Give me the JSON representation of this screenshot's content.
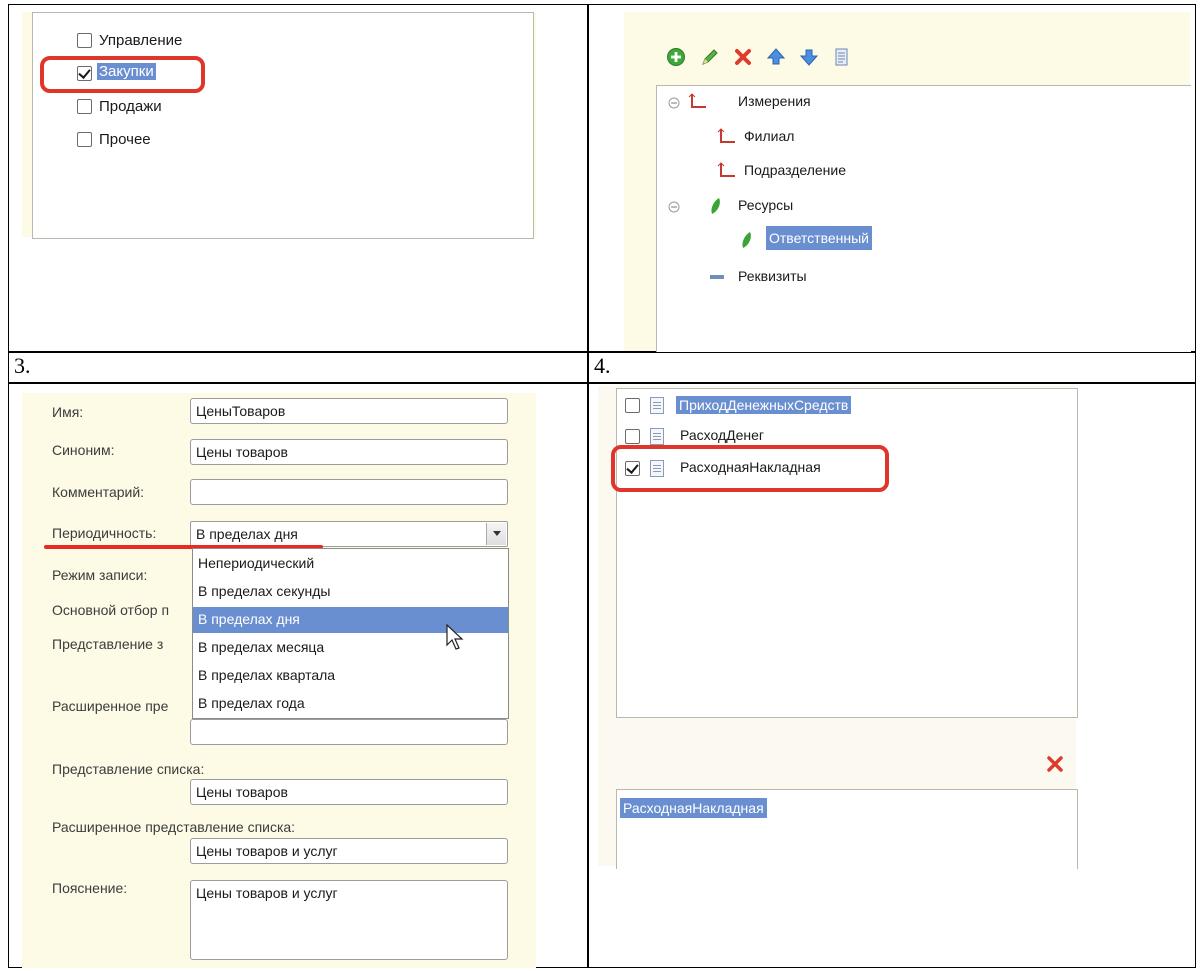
{
  "cell_numbers": {
    "c3": "3.",
    "c4": "4."
  },
  "panel1": {
    "items": [
      {
        "label": "Управление",
        "checked": false
      },
      {
        "label": "Закупки",
        "checked": true
      },
      {
        "label": "Продажи",
        "checked": false
      },
      {
        "label": "Прочее",
        "checked": false
      }
    ]
  },
  "panel2": {
    "tree": {
      "dimensions": "Измерения",
      "dim_items": [
        "Филиал",
        "Подразделение"
      ],
      "resources": "Ресурсы",
      "res_items": [
        "Ответственный"
      ],
      "attributes": "Реквизиты"
    }
  },
  "panel3": {
    "name_label": "Имя:",
    "name_value": "ЦеныТоваров",
    "synonym_label": "Синоним:",
    "synonym_value": "Цены товаров",
    "comment_label": "Комментарий:",
    "comment_value": "",
    "periodicity_label": "Периодичность:",
    "periodicity_value": "В пределах дня",
    "write_mode_label": "Режим записи:",
    "main_filter_label": "Основной отбор п",
    "record_repr_label": "Представление з",
    "ext_repr_label": "Расширенное пре",
    "dropdown_options": [
      "Непериодический",
      "В пределах секунды",
      "В пределах дня",
      "В пределах месяца",
      "В пределах квартала",
      "В пределах года"
    ],
    "list_repr_label": "Представление списка:",
    "list_repr_value": "Цены товаров",
    "ext_list_repr_label": "Расширенное представление списка:",
    "ext_list_repr_value": "Цены товаров и услуг",
    "explanation_label": "Пояснение:",
    "explanation_value": "Цены товаров и услуг"
  },
  "panel4": {
    "documents": [
      {
        "label": "ПриходДенежныхСредств",
        "checked": false
      },
      {
        "label": "РасходДенег",
        "checked": false
      },
      {
        "label": "РасходнаяНакладная",
        "checked": true
      }
    ],
    "selected": "РасходнаяНакладная"
  },
  "colors": {
    "accent_red": "#e0352b",
    "selection": "#6a8fd0",
    "panel_bg": "#fdfae6"
  }
}
